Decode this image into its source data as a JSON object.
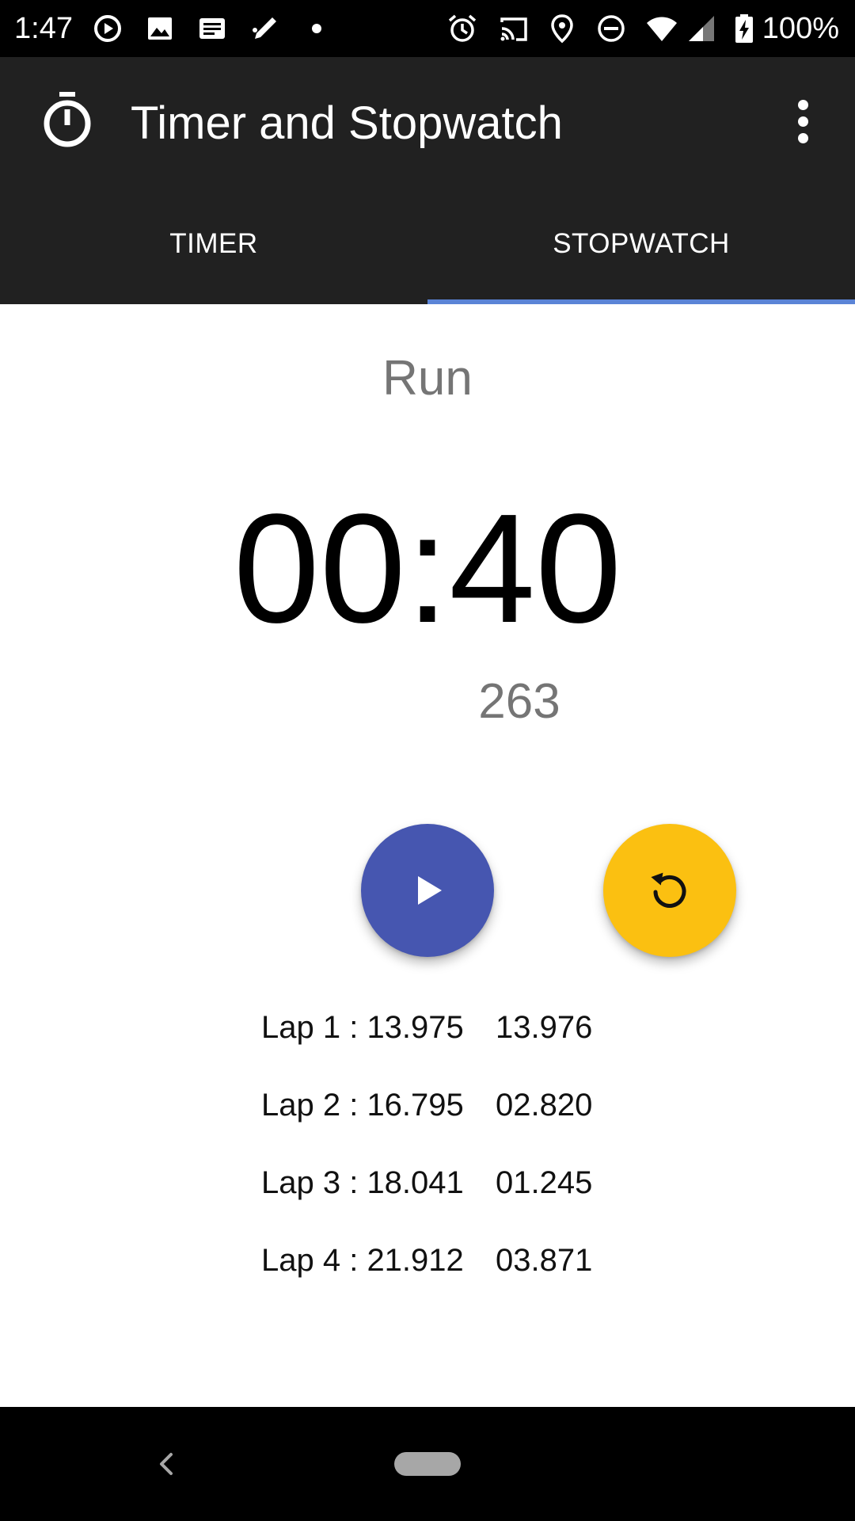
{
  "status_bar": {
    "time": "1:47",
    "battery_percent": "100%",
    "notification_icons": [
      "play-circle-icon",
      "image-icon",
      "news-icon",
      "pen-icon",
      "dot-icon"
    ],
    "system_icons": [
      "alarm-icon",
      "cast-icon",
      "location-icon",
      "do-not-disturb-icon",
      "wifi-icon",
      "signal-icon",
      "battery-charging-icon"
    ]
  },
  "app_bar": {
    "title": "Timer and Stopwatch",
    "icon": "stopwatch-icon",
    "menu_icon": "overflow-menu-icon"
  },
  "tabs": [
    {
      "label": "TIMER",
      "selected": false
    },
    {
      "label": "STOPWATCH",
      "selected": true
    }
  ],
  "stopwatch": {
    "label": "Run",
    "time": "00:40",
    "millis": "263"
  },
  "buttons": {
    "play_icon": "play-icon",
    "reset_icon": "reset-icon"
  },
  "laps": [
    {
      "label": "Lap 1 : 13.975",
      "split": "13.976"
    },
    {
      "label": "Lap 2 : 16.795",
      "split": "02.820"
    },
    {
      "label": "Lap 3 : 18.041",
      "split": "01.245"
    },
    {
      "label": "Lap 4 : 21.912",
      "split": "03.871"
    }
  ],
  "colors": {
    "app_bar": "#212121",
    "tab_indicator": "#5b84d6",
    "play_button": "#4656b0",
    "reset_button": "#fbc011"
  }
}
